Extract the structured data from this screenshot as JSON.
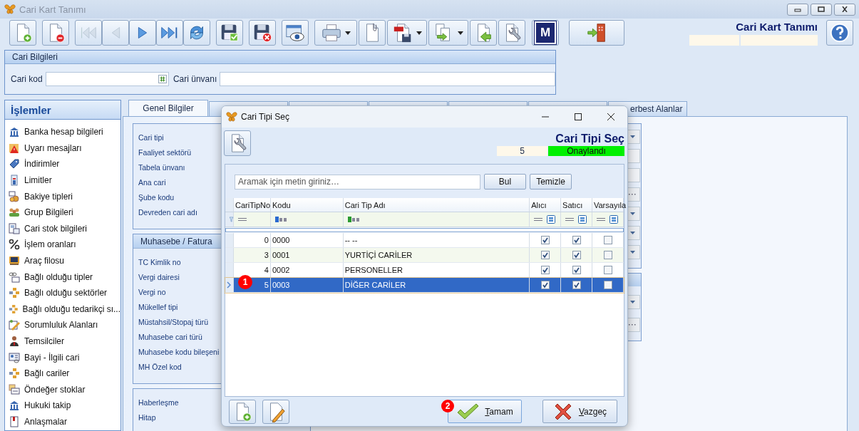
{
  "window": {
    "title": "Cari Kart Tanımı"
  },
  "toolbar": [
    {
      "disabled": false,
      "dropdown": false
    },
    {
      "disabled": false,
      "dropdown": false
    },
    {
      "disabled": true,
      "dropdown": false
    },
    {
      "disabled": true,
      "dropdown": false
    },
    {
      "disabled": false,
      "dropdown": false
    },
    {
      "disabled": false,
      "dropdown": false
    },
    {
      "disabled": false,
      "dropdown": false
    },
    {
      "disabled": false,
      "dropdown": false
    },
    {
      "disabled": false,
      "dropdown": false
    },
    {
      "disabled": false,
      "dropdown": false
    },
    {
      "disabled": false,
      "dropdown": true
    },
    {
      "disabled": false,
      "dropdown": false
    },
    {
      "disabled": false,
      "dropdown": true
    },
    {
      "disabled": false,
      "dropdown": true
    },
    {
      "disabled": false,
      "dropdown": false
    },
    {
      "disabled": false,
      "dropdown": false
    },
    {
      "disabled": false,
      "dropdown": false,
      "label": "M"
    },
    {
      "disabled": false,
      "dropdown": false
    }
  ],
  "header": {
    "title": "Cari Kart Tanımı"
  },
  "cari_bilgileri": {
    "title": "Cari Bilgileri",
    "fields": [
      {
        "label": "Cari kod"
      },
      {
        "label": "Cari ünvanı"
      }
    ]
  },
  "sidebar": {
    "title": "İşlemler",
    "items": [
      "Banka hesap bilgileri",
      "Uyarı mesajları",
      "İndirimler",
      "Limitler",
      "Bakiye tipleri",
      "Grup Bilgileri",
      "Cari stok bilgileri",
      "İşlem oranları",
      "Araç filosu",
      "Bağlı olduğu tipler",
      "Bağlı olduğu sektörler",
      "Bağlı olduğu tedarikçi sı...",
      "Sorumluluk Alanları",
      "Temsilciler",
      "Bayi - İlgili cari",
      "Bağlı cariler",
      "Öndeğer stoklar",
      "Hukuki takip",
      "Anlaşmalar"
    ]
  },
  "tabs": [
    {
      "label": "Genel Bilgiler",
      "selected": true
    },
    {
      "selected": false
    },
    {
      "selected": false
    },
    {
      "selected": false
    },
    {
      "selected": false
    },
    {
      "selected": false
    },
    {
      "label": "erbest Alanlar",
      "selected": false
    }
  ],
  "general": {
    "groups": [
      {
        "labels": [
          "Cari tipi",
          "Faaliyet sektörü",
          "Tabela ünvanı",
          "Ana cari",
          "Şube kodu",
          "Devreden cari adı"
        ]
      },
      {
        "title": "Muhasebe / Fatura",
        "labels": [
          "TC Kimlik no",
          "Vergi dairesi",
          "Vergi no",
          "Mükellef tipi",
          "Müstahsil/Stopaj türü",
          "Muhasebe cari türü",
          "Muhasebe kodu bileşeni",
          "MH Özel kod"
        ]
      },
      {
        "labels": [
          "Haberleşme",
          "Hitap"
        ]
      }
    ],
    "side_groups": [
      {
        "buttons": [
          {
            "kind": "dropdown"
          },
          {
            "kind": "field"
          },
          {
            "kind": "field"
          },
          {
            "kind": "ellipsis"
          },
          {
            "kind": "dropdown"
          },
          {
            "kind": "dropdown"
          },
          {
            "kind": "dropdown"
          }
        ]
      },
      {
        "buttons": [
          {
            "kind": "dropdown"
          },
          {
            "kind": "ellipsis"
          }
        ]
      }
    ]
  },
  "dialog": {
    "title": "Cari Tipi Seç",
    "heading": "Cari Tipi Seç",
    "count": "5",
    "status": "Onaylandı",
    "search": {
      "placeholder": "Aramak için metin giriniz…"
    },
    "search_buttons": [
      "Bul",
      "Temizle"
    ],
    "columns": [
      "CariTipNo",
      "Kodu",
      "Cari Tip Adı",
      "Alıcı",
      "Satıcı",
      "Varsayıla"
    ],
    "rows": [
      {
        "no": "0",
        "code": "0000",
        "name": "-- --",
        "buyer": true,
        "seller": true,
        "default": false,
        "selected": false
      },
      {
        "no": "3",
        "code": "0001",
        "name": "YURTİÇİ CARİLER",
        "buyer": true,
        "seller": true,
        "default": false,
        "selected": false
      },
      {
        "no": "4",
        "code": "0002",
        "name": "PERSONELLER",
        "buyer": true,
        "seller": true,
        "default": false,
        "selected": false
      },
      {
        "no": "5",
        "code": "0003",
        "name": "DİĞER CARİLER",
        "buyer": true,
        "seller": true,
        "default": false,
        "selected": true,
        "badge": "1"
      }
    ],
    "ok": {
      "label": "Tamam",
      "badge": "2"
    },
    "cancel": {
      "label": "Vazgeç"
    }
  }
}
